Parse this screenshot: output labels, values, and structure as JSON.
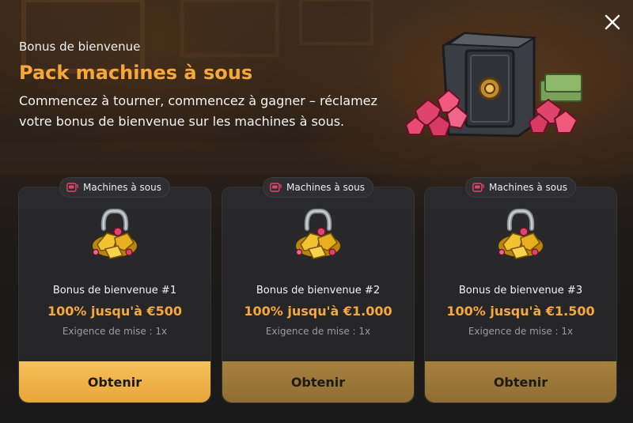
{
  "modal": {
    "close_icon": "close-icon",
    "eyebrow": "Bonus de bienvenue",
    "title": "Pack machines à sous",
    "subtitle": "Commencez à tourner, commencez à gagner – réclamez votre bonus de bienvenue sur les machines à sous.",
    "accent_color": "#f6a93b",
    "hero_icon": "treasure-safe-with-gems-icon"
  },
  "cards": [
    {
      "tag_icon": "slot-machine-icon",
      "tag": "Machines à sous",
      "loot_icon": "horseshoe-gold-loot-icon",
      "title": "Bonus de bienvenue #1",
      "offer": "100% jusqu'à €500",
      "requirement": "Exigence de mise : 1x",
      "cta": "Obtenir",
      "cta_style": "primary"
    },
    {
      "tag_icon": "slot-machine-icon",
      "tag": "Machines à sous",
      "loot_icon": "horseshoe-gold-loot-icon",
      "title": "Bonus de bienvenue #2",
      "offer": "100% jusqu'à €1.000",
      "requirement": "Exigence de mise : 1x",
      "cta": "Obtenir",
      "cta_style": "muted"
    },
    {
      "tag_icon": "slot-machine-icon",
      "tag": "Machines à sous",
      "loot_icon": "horseshoe-gold-loot-icon",
      "title": "Bonus de bienvenue #3",
      "offer": "100% jusqu'à €1.500",
      "requirement": "Exigence de mise : 1x",
      "cta": "Obtenir",
      "cta_style": "muted"
    }
  ]
}
